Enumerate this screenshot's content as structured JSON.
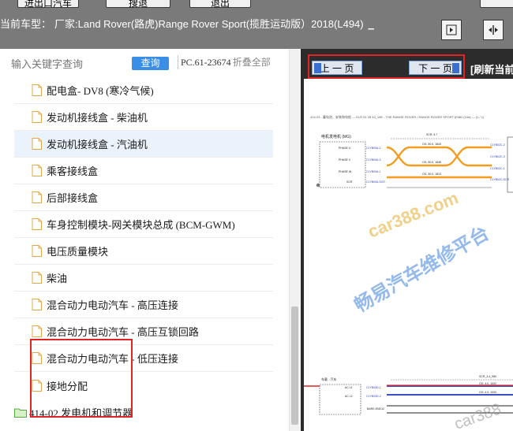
{
  "top_buttons": [
    "进出口汽车",
    "搜退",
    "退出"
  ],
  "header": {
    "model_label": "当前车型：",
    "model_value": "厂家:Land Rover(路虎)Range Rover Sport(揽胜运动版）2018(L494)",
    "underscore": "_"
  },
  "header_icons": [
    "collapse-panel-icon",
    "split-view-icon"
  ],
  "search": {
    "placeholder": "输入关键字查询",
    "button_label": "查询",
    "pc_code": "PC.61-23674",
    "collapse_all": "折叠全部"
  },
  "tree": {
    "items": [
      {
        "label": "配电盒- DV8 (寒冷气候)"
      },
      {
        "label": "发动机接线盒 - 柴油机"
      },
      {
        "label": "发动机接线盒 - 汽油机"
      },
      {
        "label": "乘客接线盒"
      },
      {
        "label": "后部接线盒"
      },
      {
        "label": "车身控制模块-网关模块总成 (BCM-GWM)"
      },
      {
        "label": "电压质量模块"
      },
      {
        "label": "柴油"
      },
      {
        "label": "混合动力电动汽车 - 高压连接"
      },
      {
        "label": "混合动力电动汽车 - 高压互锁回路"
      },
      {
        "label": "混合动力电动汽车 - 低压连接"
      },
      {
        "label": "接地分配"
      }
    ],
    "selected_index": 2,
    "folder": {
      "label": "414-02 发电机和调节器"
    }
  },
  "viewer": {
    "prev_label": "上 一 页",
    "next_label": "下 一 页",
    "refresh_label": "[刷新当前"
  },
  "diagram": {
    "title": "414-03 - 蓄电池、安装和电缆 — ELR 01 28 43_10E - THE RANGE ROVER / RANGE ROVER SPORT (EMD (10a) — (1 / 1)",
    "labels": [
      "电机发电机 (MG)",
      "PHASE U",
      "PHASE V",
      "PHASE W",
      "SCR",
      "C1YB00A-2",
      "C1YB00A-3",
      "C1YB00A-1",
      "C1YB00A-SCR",
      "SCR, 4.7",
      "OG, 50.0, 1843",
      "OG, 50.0, 1848",
      "OG, 50.0, 1813",
      "C1YB02C-2",
      "C1YB02C-3",
      "C1YB02C-1",
      "C1YB02C-SCR",
      "车载 - 汽车",
      "AC L1",
      "AC L2",
      "BARE-END12",
      "SCR_3.4_980",
      "C1YB03D-1",
      "C1YB03D-2",
      "OG, 4.0, 1002",
      "OG, 4.0, 1000"
    ],
    "watermarks": [
      "car388.com",
      "畅易汽车维修平台",
      "car388"
    ]
  },
  "colors": {
    "topbar_bg": "#7a7a7a",
    "query_button": "#3a8ee6",
    "highlight_red": "#e02424",
    "wire_orange": "#f39c1f",
    "wire_blue": "#3b4fc4",
    "selected_row": "#eaf2fb"
  }
}
